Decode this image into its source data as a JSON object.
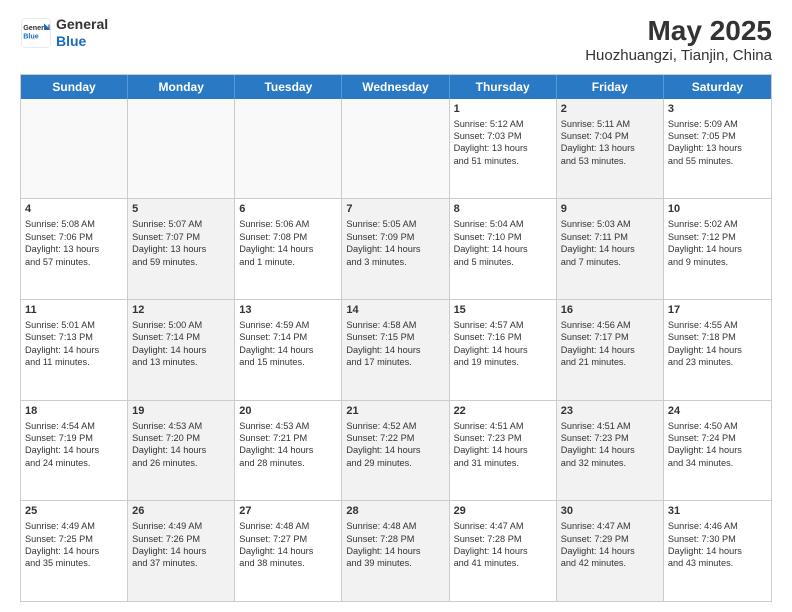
{
  "header": {
    "logo_general": "General",
    "logo_blue": "Blue",
    "title": "May 2025",
    "subtitle": "Huozhuangzi, Tianjin, China"
  },
  "weekdays": [
    "Sunday",
    "Monday",
    "Tuesday",
    "Wednesday",
    "Thursday",
    "Friday",
    "Saturday"
  ],
  "rows": [
    [
      {
        "day": "",
        "content": "",
        "shaded": false,
        "empty": true
      },
      {
        "day": "",
        "content": "",
        "shaded": false,
        "empty": true
      },
      {
        "day": "",
        "content": "",
        "shaded": false,
        "empty": true
      },
      {
        "day": "",
        "content": "",
        "shaded": false,
        "empty": true
      },
      {
        "day": "1",
        "content": "Sunrise: 5:12 AM\nSunset: 7:03 PM\nDaylight: 13 hours\nand 51 minutes.",
        "shaded": false,
        "empty": false
      },
      {
        "day": "2",
        "content": "Sunrise: 5:11 AM\nSunset: 7:04 PM\nDaylight: 13 hours\nand 53 minutes.",
        "shaded": true,
        "empty": false
      },
      {
        "day": "3",
        "content": "Sunrise: 5:09 AM\nSunset: 7:05 PM\nDaylight: 13 hours\nand 55 minutes.",
        "shaded": false,
        "empty": false
      }
    ],
    [
      {
        "day": "4",
        "content": "Sunrise: 5:08 AM\nSunset: 7:06 PM\nDaylight: 13 hours\nand 57 minutes.",
        "shaded": false,
        "empty": false
      },
      {
        "day": "5",
        "content": "Sunrise: 5:07 AM\nSunset: 7:07 PM\nDaylight: 13 hours\nand 59 minutes.",
        "shaded": true,
        "empty": false
      },
      {
        "day": "6",
        "content": "Sunrise: 5:06 AM\nSunset: 7:08 PM\nDaylight: 14 hours\nand 1 minute.",
        "shaded": false,
        "empty": false
      },
      {
        "day": "7",
        "content": "Sunrise: 5:05 AM\nSunset: 7:09 PM\nDaylight: 14 hours\nand 3 minutes.",
        "shaded": true,
        "empty": false
      },
      {
        "day": "8",
        "content": "Sunrise: 5:04 AM\nSunset: 7:10 PM\nDaylight: 14 hours\nand 5 minutes.",
        "shaded": false,
        "empty": false
      },
      {
        "day": "9",
        "content": "Sunrise: 5:03 AM\nSunset: 7:11 PM\nDaylight: 14 hours\nand 7 minutes.",
        "shaded": true,
        "empty": false
      },
      {
        "day": "10",
        "content": "Sunrise: 5:02 AM\nSunset: 7:12 PM\nDaylight: 14 hours\nand 9 minutes.",
        "shaded": false,
        "empty": false
      }
    ],
    [
      {
        "day": "11",
        "content": "Sunrise: 5:01 AM\nSunset: 7:13 PM\nDaylight: 14 hours\nand 11 minutes.",
        "shaded": false,
        "empty": false
      },
      {
        "day": "12",
        "content": "Sunrise: 5:00 AM\nSunset: 7:14 PM\nDaylight: 14 hours\nand 13 minutes.",
        "shaded": true,
        "empty": false
      },
      {
        "day": "13",
        "content": "Sunrise: 4:59 AM\nSunset: 7:14 PM\nDaylight: 14 hours\nand 15 minutes.",
        "shaded": false,
        "empty": false
      },
      {
        "day": "14",
        "content": "Sunrise: 4:58 AM\nSunset: 7:15 PM\nDaylight: 14 hours\nand 17 minutes.",
        "shaded": true,
        "empty": false
      },
      {
        "day": "15",
        "content": "Sunrise: 4:57 AM\nSunset: 7:16 PM\nDaylight: 14 hours\nand 19 minutes.",
        "shaded": false,
        "empty": false
      },
      {
        "day": "16",
        "content": "Sunrise: 4:56 AM\nSunset: 7:17 PM\nDaylight: 14 hours\nand 21 minutes.",
        "shaded": true,
        "empty": false
      },
      {
        "day": "17",
        "content": "Sunrise: 4:55 AM\nSunset: 7:18 PM\nDaylight: 14 hours\nand 23 minutes.",
        "shaded": false,
        "empty": false
      }
    ],
    [
      {
        "day": "18",
        "content": "Sunrise: 4:54 AM\nSunset: 7:19 PM\nDaylight: 14 hours\nand 24 minutes.",
        "shaded": false,
        "empty": false
      },
      {
        "day": "19",
        "content": "Sunrise: 4:53 AM\nSunset: 7:20 PM\nDaylight: 14 hours\nand 26 minutes.",
        "shaded": true,
        "empty": false
      },
      {
        "day": "20",
        "content": "Sunrise: 4:53 AM\nSunset: 7:21 PM\nDaylight: 14 hours\nand 28 minutes.",
        "shaded": false,
        "empty": false
      },
      {
        "day": "21",
        "content": "Sunrise: 4:52 AM\nSunset: 7:22 PM\nDaylight: 14 hours\nand 29 minutes.",
        "shaded": true,
        "empty": false
      },
      {
        "day": "22",
        "content": "Sunrise: 4:51 AM\nSunset: 7:23 PM\nDaylight: 14 hours\nand 31 minutes.",
        "shaded": false,
        "empty": false
      },
      {
        "day": "23",
        "content": "Sunrise: 4:51 AM\nSunset: 7:23 PM\nDaylight: 14 hours\nand 32 minutes.",
        "shaded": true,
        "empty": false
      },
      {
        "day": "24",
        "content": "Sunrise: 4:50 AM\nSunset: 7:24 PM\nDaylight: 14 hours\nand 34 minutes.",
        "shaded": false,
        "empty": false
      }
    ],
    [
      {
        "day": "25",
        "content": "Sunrise: 4:49 AM\nSunset: 7:25 PM\nDaylight: 14 hours\nand 35 minutes.",
        "shaded": false,
        "empty": false
      },
      {
        "day": "26",
        "content": "Sunrise: 4:49 AM\nSunset: 7:26 PM\nDaylight: 14 hours\nand 37 minutes.",
        "shaded": true,
        "empty": false
      },
      {
        "day": "27",
        "content": "Sunrise: 4:48 AM\nSunset: 7:27 PM\nDaylight: 14 hours\nand 38 minutes.",
        "shaded": false,
        "empty": false
      },
      {
        "day": "28",
        "content": "Sunrise: 4:48 AM\nSunset: 7:28 PM\nDaylight: 14 hours\nand 39 minutes.",
        "shaded": true,
        "empty": false
      },
      {
        "day": "29",
        "content": "Sunrise: 4:47 AM\nSunset: 7:28 PM\nDaylight: 14 hours\nand 41 minutes.",
        "shaded": false,
        "empty": false
      },
      {
        "day": "30",
        "content": "Sunrise: 4:47 AM\nSunset: 7:29 PM\nDaylight: 14 hours\nand 42 minutes.",
        "shaded": true,
        "empty": false
      },
      {
        "day": "31",
        "content": "Sunrise: 4:46 AM\nSunset: 7:30 PM\nDaylight: 14 hours\nand 43 minutes.",
        "shaded": false,
        "empty": false
      }
    ]
  ]
}
